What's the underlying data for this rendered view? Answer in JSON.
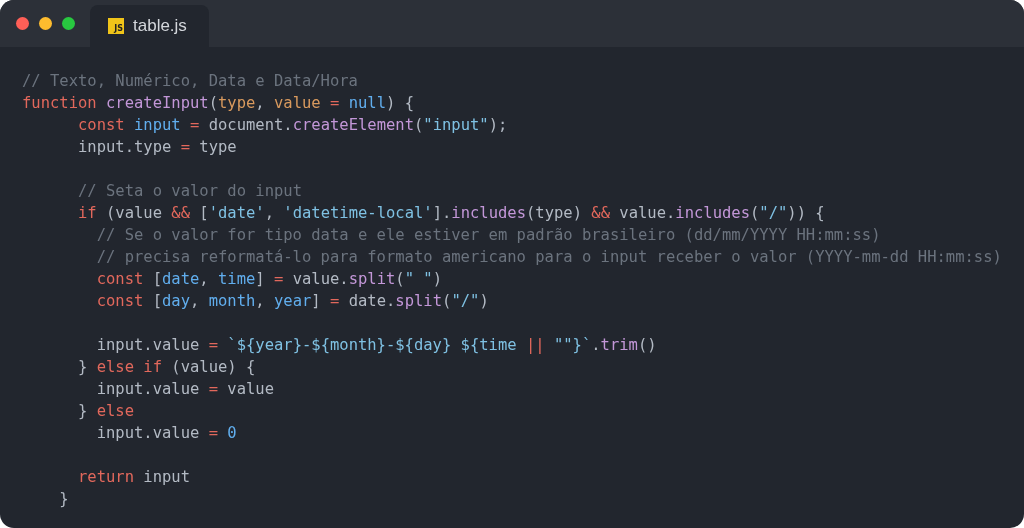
{
  "window": {
    "tabs": [
      {
        "label": "table.js",
        "badge": "JS",
        "selected": true
      }
    ]
  },
  "code": {
    "lines": [
      {
        "kind": "code",
        "tokens": [
          {
            "kind": "comment",
            "text": "// Texto, Numérico, Data e Data/Hora"
          }
        ]
      },
      {
        "kind": "code",
        "tokens": [
          {
            "kind": "keyword",
            "text": "function "
          },
          {
            "kind": "function",
            "text": "createInput"
          },
          {
            "kind": "plain",
            "text": "("
          },
          {
            "kind": "param",
            "text": "type"
          },
          {
            "kind": "plain",
            "text": ", "
          },
          {
            "kind": "param",
            "text": "value "
          },
          {
            "kind": "operator",
            "text": "= "
          },
          {
            "kind": "constant",
            "text": "null"
          },
          {
            "kind": "plain",
            "text": ") {"
          }
        ]
      },
      {
        "kind": "code",
        "tokens": [
          {
            "kind": "keyword",
            "text": "      const "
          },
          {
            "kind": "variable",
            "text": "input "
          },
          {
            "kind": "operator",
            "text": "= "
          },
          {
            "kind": "plain",
            "text": "document."
          },
          {
            "kind": "function",
            "text": "createElement"
          },
          {
            "kind": "plain",
            "text": "("
          },
          {
            "kind": "string",
            "text": "\"input\""
          },
          {
            "kind": "plain",
            "text": ");"
          }
        ]
      },
      {
        "kind": "code",
        "tokens": [
          {
            "kind": "plain",
            "text": "      input.type "
          },
          {
            "kind": "operator",
            "text": "= "
          },
          {
            "kind": "plain",
            "text": "type"
          }
        ]
      },
      {
        "kind": "blank"
      },
      {
        "kind": "code",
        "tokens": [
          {
            "kind": "comment",
            "text": "      // Seta o valor do input"
          }
        ]
      },
      {
        "kind": "code",
        "tokens": [
          {
            "kind": "keyword",
            "text": "      if "
          },
          {
            "kind": "plain",
            "text": "(value "
          },
          {
            "kind": "operator",
            "text": "&& "
          },
          {
            "kind": "plain",
            "text": "["
          },
          {
            "kind": "string",
            "text": "'date'"
          },
          {
            "kind": "plain",
            "text": ", "
          },
          {
            "kind": "string",
            "text": "'datetime-local'"
          },
          {
            "kind": "plain",
            "text": "]."
          },
          {
            "kind": "function",
            "text": "includes"
          },
          {
            "kind": "plain",
            "text": "(type) "
          },
          {
            "kind": "operator",
            "text": "&& "
          },
          {
            "kind": "plain",
            "text": "value."
          },
          {
            "kind": "function",
            "text": "includes"
          },
          {
            "kind": "plain",
            "text": "("
          },
          {
            "kind": "string",
            "text": "\"/\""
          },
          {
            "kind": "plain",
            "text": ")) {"
          }
        ]
      },
      {
        "kind": "code",
        "tokens": [
          {
            "kind": "comment",
            "text": "        // Se o valor for tipo data e ele estiver em padrão brasileiro (dd/mm/YYYY HH:mm:ss)"
          }
        ]
      },
      {
        "kind": "code",
        "tokens": [
          {
            "kind": "comment",
            "text": "        // precisa reformatá-lo para formato americano para o input receber o valor (YYYY-mm-dd HH:mm:ss)"
          }
        ]
      },
      {
        "kind": "code",
        "tokens": [
          {
            "kind": "keyword",
            "text": "        const "
          },
          {
            "kind": "plain",
            "text": "["
          },
          {
            "kind": "variable",
            "text": "date"
          },
          {
            "kind": "plain",
            "text": ", "
          },
          {
            "kind": "variable",
            "text": "time"
          },
          {
            "kind": "plain",
            "text": "] "
          },
          {
            "kind": "operator",
            "text": "= "
          },
          {
            "kind": "plain",
            "text": "value."
          },
          {
            "kind": "function",
            "text": "split"
          },
          {
            "kind": "plain",
            "text": "("
          },
          {
            "kind": "string",
            "text": "\" \""
          },
          {
            "kind": "plain",
            "text": ")"
          }
        ]
      },
      {
        "kind": "code",
        "tokens": [
          {
            "kind": "keyword",
            "text": "        const "
          },
          {
            "kind": "plain",
            "text": "["
          },
          {
            "kind": "variable",
            "text": "day"
          },
          {
            "kind": "plain",
            "text": ", "
          },
          {
            "kind": "variable",
            "text": "month"
          },
          {
            "kind": "plain",
            "text": ", "
          },
          {
            "kind": "variable",
            "text": "year"
          },
          {
            "kind": "plain",
            "text": "] "
          },
          {
            "kind": "operator",
            "text": "= "
          },
          {
            "kind": "plain",
            "text": "date."
          },
          {
            "kind": "function",
            "text": "split"
          },
          {
            "kind": "plain",
            "text": "("
          },
          {
            "kind": "string",
            "text": "\"/\""
          },
          {
            "kind": "plain",
            "text": ")"
          }
        ]
      },
      {
        "kind": "blank"
      },
      {
        "kind": "code",
        "tokens": [
          {
            "kind": "plain",
            "text": "        input.value "
          },
          {
            "kind": "operator",
            "text": "= "
          },
          {
            "kind": "string",
            "text": "`${year}-${month}-${day} ${time "
          },
          {
            "kind": "operator",
            "text": "|| "
          },
          {
            "kind": "string",
            "text": "\"\"}`"
          },
          {
            "kind": "plain",
            "text": "."
          },
          {
            "kind": "function",
            "text": "trim"
          },
          {
            "kind": "plain",
            "text": "()"
          }
        ]
      },
      {
        "kind": "code",
        "tokens": [
          {
            "kind": "plain",
            "text": "      } "
          },
          {
            "kind": "keyword",
            "text": "else if "
          },
          {
            "kind": "plain",
            "text": "(value) {"
          }
        ]
      },
      {
        "kind": "code",
        "tokens": [
          {
            "kind": "plain",
            "text": "        input.value "
          },
          {
            "kind": "operator",
            "text": "= "
          },
          {
            "kind": "plain",
            "text": "value"
          }
        ]
      },
      {
        "kind": "code",
        "tokens": [
          {
            "kind": "plain",
            "text": "      } "
          },
          {
            "kind": "keyword",
            "text": "else"
          }
        ]
      },
      {
        "kind": "code",
        "tokens": [
          {
            "kind": "plain",
            "text": "        input.value "
          },
          {
            "kind": "operator",
            "text": "= "
          },
          {
            "kind": "constant",
            "text": "0"
          }
        ]
      },
      {
        "kind": "blank"
      },
      {
        "kind": "code",
        "tokens": [
          {
            "kind": "keyword",
            "text": "      return "
          },
          {
            "kind": "plain",
            "text": "input"
          }
        ]
      },
      {
        "kind": "code",
        "tokens": [
          {
            "kind": "plain",
            "text": "    }"
          }
        ]
      }
    ]
  }
}
